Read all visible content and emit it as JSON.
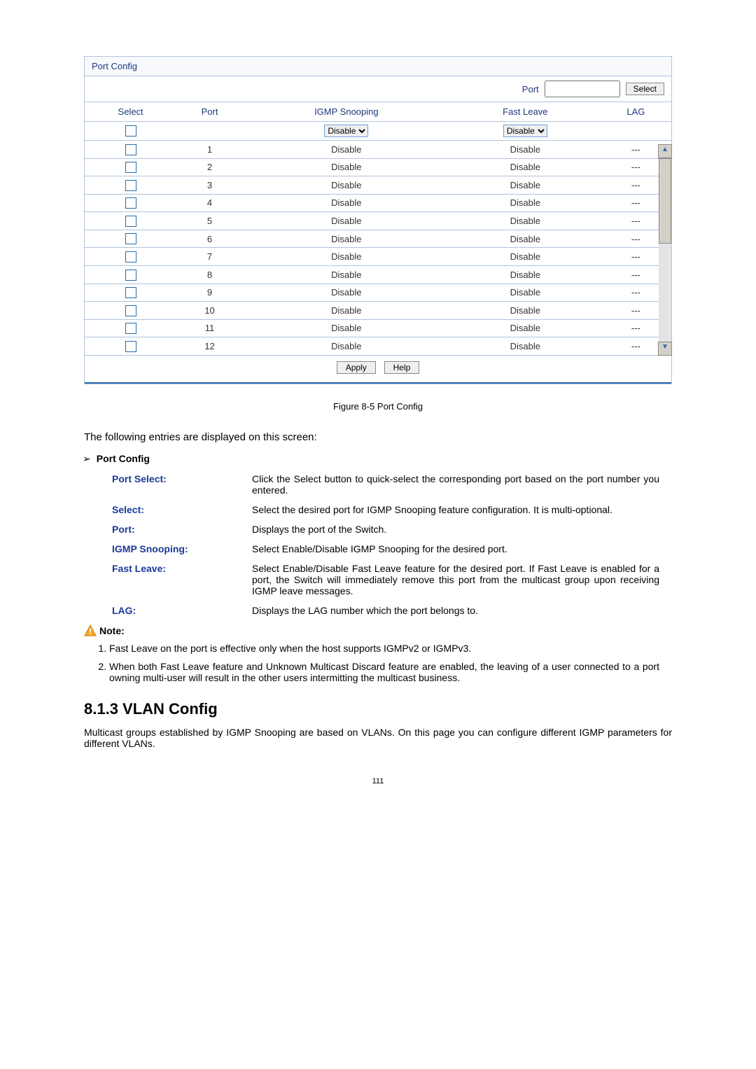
{
  "panel": {
    "title": "Port Config",
    "portLabel": "Port",
    "selectBtn": "Select",
    "headers": [
      "Select",
      "Port",
      "IGMP Snooping",
      "Fast Leave",
      "LAG"
    ],
    "filterRow": {
      "snoopOption": "Disable",
      "leaveOption": "Disable"
    },
    "rows": [
      {
        "port": "1",
        "snoop": "Disable",
        "leave": "Disable",
        "lag": "---"
      },
      {
        "port": "2",
        "snoop": "Disable",
        "leave": "Disable",
        "lag": "---"
      },
      {
        "port": "3",
        "snoop": "Disable",
        "leave": "Disable",
        "lag": "---"
      },
      {
        "port": "4",
        "snoop": "Disable",
        "leave": "Disable",
        "lag": "---"
      },
      {
        "port": "5",
        "snoop": "Disable",
        "leave": "Disable",
        "lag": "---"
      },
      {
        "port": "6",
        "snoop": "Disable",
        "leave": "Disable",
        "lag": "---"
      },
      {
        "port": "7",
        "snoop": "Disable",
        "leave": "Disable",
        "lag": "---"
      },
      {
        "port": "8",
        "snoop": "Disable",
        "leave": "Disable",
        "lag": "---"
      },
      {
        "port": "9",
        "snoop": "Disable",
        "leave": "Disable",
        "lag": "---"
      },
      {
        "port": "10",
        "snoop": "Disable",
        "leave": "Disable",
        "lag": "---"
      },
      {
        "port": "11",
        "snoop": "Disable",
        "leave": "Disable",
        "lag": "---"
      },
      {
        "port": "12",
        "snoop": "Disable",
        "leave": "Disable",
        "lag": "---"
      }
    ],
    "applyBtn": "Apply",
    "helpBtn": "Help"
  },
  "figureCaption": "Figure 8-5 Port Config",
  "intro": "The following entries are displayed on this screen:",
  "bulletHead": "Port Config",
  "defs": [
    {
      "label": "Port Select:",
      "text": "Click the Select button to quick-select the corresponding port based on the port number you entered."
    },
    {
      "label": "Select:",
      "text": "Select the desired port for IGMP Snooping feature configuration. It is multi-optional."
    },
    {
      "label": "Port:",
      "text": "Displays the port of the Switch."
    },
    {
      "label": "IGMP Snooping:",
      "text": "Select Enable/Disable IGMP Snooping for the desired port."
    },
    {
      "label": "Fast Leave:",
      "text": "Select Enable/Disable Fast Leave feature for the desired port. If Fast Leave is enabled for a port, the Switch will immediately remove this port from the multicast group upon receiving IGMP leave messages."
    },
    {
      "label": "LAG:",
      "text": "Displays the LAG number which the port belongs to."
    }
  ],
  "noteLabel": "Note:",
  "notes": [
    "Fast Leave on the port is effective only when the host supports IGMPv2 or IGMPv3.",
    "When both Fast Leave feature and Unknown Multicast Discard feature are enabled, the leaving of a user connected to a port owning multi-user will result in the other users intermitting the multicast business."
  ],
  "sectionHeading": "8.1.3 VLAN Config",
  "sectionPara": "Multicast groups established by IGMP Snooping are based on VLANs. On this page you can configure different IGMP parameters for different VLANs.",
  "pageNumber": "111"
}
